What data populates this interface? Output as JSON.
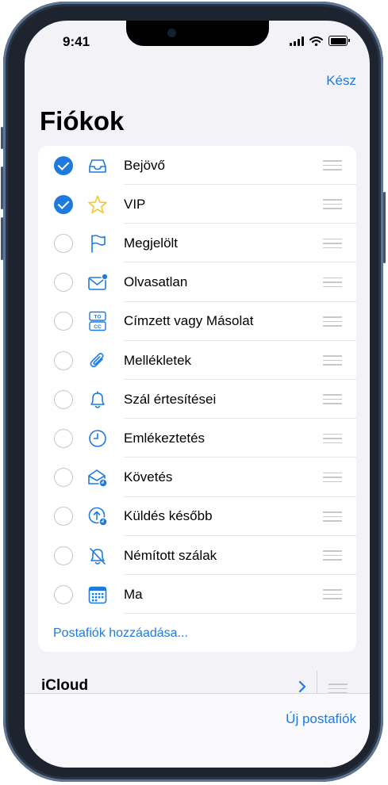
{
  "status_bar": {
    "time": "9:41"
  },
  "nav": {
    "done_label": "Kész",
    "title": "Fiókok"
  },
  "mailboxes": [
    {
      "label": "Bejövő",
      "checked": true,
      "icon": "inbox-tray-icon"
    },
    {
      "label": "VIP",
      "checked": true,
      "icon": "star-icon"
    },
    {
      "label": "Megjelölt",
      "checked": false,
      "icon": "flag-icon"
    },
    {
      "label": "Olvasatlan",
      "checked": false,
      "icon": "unread-envelope-icon"
    },
    {
      "label": "Címzett vagy Másolat",
      "checked": false,
      "icon": "to-cc-icon",
      "icon_text": [
        "TO",
        "CC"
      ]
    },
    {
      "label": "Mellékletek",
      "checked": false,
      "icon": "paperclip-icon"
    },
    {
      "label": "Szál értesítései",
      "checked": false,
      "icon": "bell-icon"
    },
    {
      "label": "Emlékeztetés",
      "checked": false,
      "icon": "clock-icon"
    },
    {
      "label": "Követés",
      "checked": false,
      "icon": "envelope-clock-icon"
    },
    {
      "label": "Küldés később",
      "checked": false,
      "icon": "send-later-icon"
    },
    {
      "label": "Némított szálak",
      "checked": false,
      "icon": "bell-slash-icon"
    },
    {
      "label": "Ma",
      "checked": false,
      "icon": "calendar-icon"
    }
  ],
  "add_mailbox_label": "Postafiók hozzáadása...",
  "icloud": {
    "label": "iCloud"
  },
  "toolbar": {
    "new_mailbox_label": "Új postafiók"
  },
  "colors": {
    "accent": "#1f7ae0",
    "star": "#f4c430",
    "background": "#f2f2f7"
  }
}
